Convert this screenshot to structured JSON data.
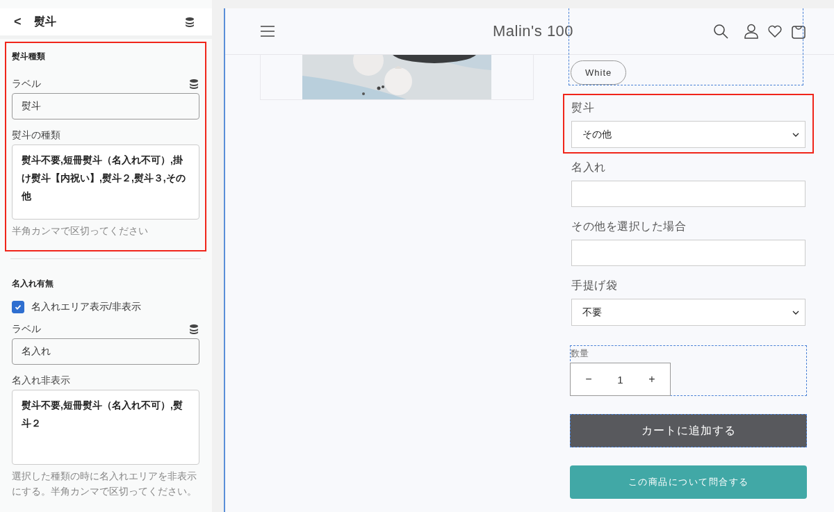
{
  "sidebar": {
    "back": "<",
    "title": "熨斗",
    "sections": [
      {
        "title": "熨斗種類",
        "highlighted": true,
        "fields": [
          {
            "kind": "input",
            "label": "ラベル",
            "dynamic": true,
            "value": "熨斗"
          },
          {
            "kind": "textarea",
            "label": "熨斗の種類",
            "value": "熨斗不要,短冊熨斗（名入れ不可）,掛け熨斗【内祝い】,熨斗２,熨斗３,その他",
            "hint": "半角カンマで区切ってください"
          }
        ]
      },
      {
        "title": "名入れ有無",
        "highlighted": false,
        "fields": [
          {
            "kind": "checkbox",
            "label": "名入れエリア表示/非表示",
            "checked": true
          },
          {
            "kind": "input",
            "label": "ラベル",
            "dynamic": true,
            "value": "名入れ"
          },
          {
            "kind": "textarea",
            "label": "名入れ非表示",
            "value": "熨斗不要,短冊熨斗（名入れ不可）,熨斗２",
            "hint": "選択した種類の時に名入れエリアを非表示にする。半角カンマで区切ってください。"
          }
        ]
      }
    ]
  },
  "preview": {
    "store_name": "Malin's 100",
    "variant_button": "White",
    "fields": [
      {
        "kind": "select",
        "label": "熨斗",
        "value": "その他",
        "highlighted": true
      },
      {
        "kind": "input",
        "label": "名入れ",
        "highlighted": false
      },
      {
        "kind": "input",
        "label": "その他を選択した場合",
        "highlighted": false
      },
      {
        "kind": "select",
        "label": "手提げ袋",
        "value": "不要",
        "highlighted": false
      }
    ],
    "quantity": {
      "label": "数量",
      "minus": "−",
      "value": "1",
      "plus": "+"
    },
    "add_to_cart": "カートに追加する",
    "inquiry": "この商品について問合する"
  }
}
